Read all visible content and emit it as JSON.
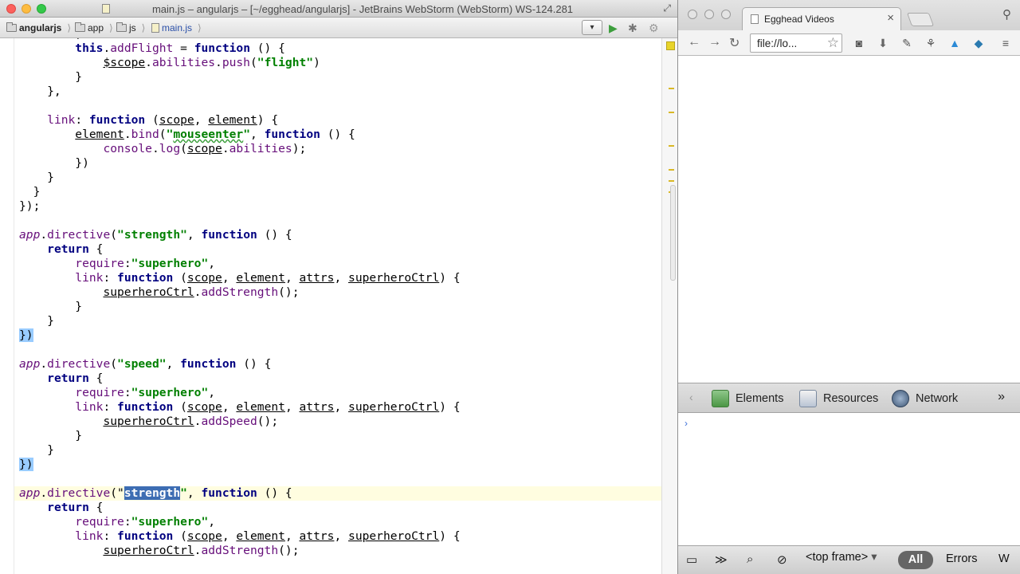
{
  "ide": {
    "title": "main.js – angularjs – [~/egghead/angularjs] - JetBrains WebStorm (WebStorm) WS-124.281",
    "breadcrumbs": [
      "angularjs",
      "app",
      "js",
      "main.js"
    ],
    "run_dropdown": "▾"
  },
  "editor": {
    "lines": [
      [
        {
          "t": "        ;"
        }
      ],
      [
        {
          "t": "        "
        },
        {
          "t": "this",
          "c": "kw"
        },
        {
          "t": "."
        },
        {
          "t": "addFlight",
          "c": "prop"
        },
        {
          "t": " = "
        },
        {
          "t": "function",
          "c": "kw"
        },
        {
          "t": " () {"
        }
      ],
      [
        {
          "t": "            "
        },
        {
          "t": "$scope",
          "c": "ul"
        },
        {
          "t": "."
        },
        {
          "t": "abilities",
          "c": "prop"
        },
        {
          "t": "."
        },
        {
          "t": "push",
          "c": "prop"
        },
        {
          "t": "("
        },
        {
          "t": "\"flight\"",
          "c": "str"
        },
        {
          "t": ")"
        }
      ],
      [
        {
          "t": "        }"
        }
      ],
      [
        {
          "t": "    },"
        }
      ],
      [
        {
          "t": ""
        }
      ],
      [
        {
          "t": "    "
        },
        {
          "t": "link",
          "c": "prop"
        },
        {
          "t": ": "
        },
        {
          "t": "function",
          "c": "kw"
        },
        {
          "t": " ("
        },
        {
          "t": "scope",
          "c": "ul"
        },
        {
          "t": ", "
        },
        {
          "t": "element",
          "c": "ul"
        },
        {
          "t": ") {"
        }
      ],
      [
        {
          "t": "        "
        },
        {
          "t": "element",
          "c": "ul"
        },
        {
          "t": "."
        },
        {
          "t": "bind",
          "c": "prop"
        },
        {
          "t": "("
        },
        {
          "t": "\"",
          "c": "str"
        },
        {
          "t": "mouseenter",
          "c": "str squig"
        },
        {
          "t": "\"",
          "c": "str"
        },
        {
          "t": ", "
        },
        {
          "t": "function",
          "c": "kw"
        },
        {
          "t": " () {"
        }
      ],
      [
        {
          "t": "            "
        },
        {
          "t": "console",
          "c": "prop"
        },
        {
          "t": "."
        },
        {
          "t": "log",
          "c": "prop"
        },
        {
          "t": "("
        },
        {
          "t": "scope",
          "c": "ul"
        },
        {
          "t": "."
        },
        {
          "t": "abilities",
          "c": "prop"
        },
        {
          "t": ");"
        }
      ],
      [
        {
          "t": "        })"
        }
      ],
      [
        {
          "t": "    }"
        }
      ],
      [
        {
          "t": "  }"
        }
      ],
      [
        {
          "t": "});"
        }
      ],
      [
        {
          "t": ""
        }
      ],
      [
        {
          "t": "app",
          "c": "obj"
        },
        {
          "t": "."
        },
        {
          "t": "directive",
          "c": "prop"
        },
        {
          "t": "("
        },
        {
          "t": "\"strength\"",
          "c": "str"
        },
        {
          "t": ", "
        },
        {
          "t": "function",
          "c": "kw"
        },
        {
          "t": " () {"
        }
      ],
      [
        {
          "t": "    "
        },
        {
          "t": "return",
          "c": "kw"
        },
        {
          "t": " {"
        }
      ],
      [
        {
          "t": "        "
        },
        {
          "t": "require",
          "c": "prop"
        },
        {
          "t": ":"
        },
        {
          "t": "\"superhero\"",
          "c": "str"
        },
        {
          "t": ","
        }
      ],
      [
        {
          "t": "        "
        },
        {
          "t": "link",
          "c": "prop"
        },
        {
          "t": ": "
        },
        {
          "t": "function",
          "c": "kw"
        },
        {
          "t": " ("
        },
        {
          "t": "scope",
          "c": "ul"
        },
        {
          "t": ", "
        },
        {
          "t": "element",
          "c": "ul"
        },
        {
          "t": ", "
        },
        {
          "t": "attrs",
          "c": "ul"
        },
        {
          "t": ", "
        },
        {
          "t": "superheroCtrl",
          "c": "ul"
        },
        {
          "t": ") {"
        }
      ],
      [
        {
          "t": "            "
        },
        {
          "t": "superheroCtrl",
          "c": "ul"
        },
        {
          "t": "."
        },
        {
          "t": "addStrength",
          "c": "prop"
        },
        {
          "t": "();"
        }
      ],
      [
        {
          "t": "        }"
        }
      ],
      [
        {
          "t": "    }"
        }
      ],
      [
        {
          "t": "})",
          "c": "br"
        }
      ],
      [
        {
          "t": ""
        }
      ],
      [
        {
          "t": "app",
          "c": "obj"
        },
        {
          "t": "."
        },
        {
          "t": "directive",
          "c": "prop"
        },
        {
          "t": "("
        },
        {
          "t": "\"speed\"",
          "c": "str"
        },
        {
          "t": ", "
        },
        {
          "t": "function",
          "c": "kw"
        },
        {
          "t": " () {"
        }
      ],
      [
        {
          "t": "    "
        },
        {
          "t": "return",
          "c": "kw"
        },
        {
          "t": " {"
        }
      ],
      [
        {
          "t": "        "
        },
        {
          "t": "require",
          "c": "prop"
        },
        {
          "t": ":"
        },
        {
          "t": "\"superhero\"",
          "c": "str"
        },
        {
          "t": ","
        }
      ],
      [
        {
          "t": "        "
        },
        {
          "t": "link",
          "c": "prop"
        },
        {
          "t": ": "
        },
        {
          "t": "function",
          "c": "kw"
        },
        {
          "t": " ("
        },
        {
          "t": "scope",
          "c": "ul"
        },
        {
          "t": ", "
        },
        {
          "t": "element",
          "c": "ul"
        },
        {
          "t": ", "
        },
        {
          "t": "attrs",
          "c": "ul"
        },
        {
          "t": ", "
        },
        {
          "t": "superheroCtrl",
          "c": "ul"
        },
        {
          "t": ") {"
        }
      ],
      [
        {
          "t": "            "
        },
        {
          "t": "superheroCtrl",
          "c": "ul"
        },
        {
          "t": "."
        },
        {
          "t": "addSpeed",
          "c": "prop"
        },
        {
          "t": "();"
        }
      ],
      [
        {
          "t": "        }"
        }
      ],
      [
        {
          "t": "    }"
        }
      ],
      [
        {
          "t": "})",
          "c": "br"
        }
      ],
      [
        {
          "t": ""
        }
      ],
      [
        {
          "t": "app",
          "c": "obj"
        },
        {
          "t": "."
        },
        {
          "t": "directive",
          "c": "prop"
        },
        {
          "t": "(\""
        },
        {
          "t": "strength",
          "c": "sel"
        },
        {
          "t": "\"",
          "c": "str"
        },
        {
          "t": ", "
        },
        {
          "t": "function",
          "c": "kw"
        },
        {
          "t": " () {"
        }
      ],
      [
        {
          "t": "    "
        },
        {
          "t": "return",
          "c": "kw"
        },
        {
          "t": " {"
        }
      ],
      [
        {
          "t": "        "
        },
        {
          "t": "require",
          "c": "prop"
        },
        {
          "t": ":"
        },
        {
          "t": "\"superhero\"",
          "c": "str"
        },
        {
          "t": ","
        }
      ],
      [
        {
          "t": "        "
        },
        {
          "t": "link",
          "c": "prop"
        },
        {
          "t": ": "
        },
        {
          "t": "function",
          "c": "kw"
        },
        {
          "t": " ("
        },
        {
          "t": "scope",
          "c": "ul"
        },
        {
          "t": ", "
        },
        {
          "t": "element",
          "c": "ul"
        },
        {
          "t": ", "
        },
        {
          "t": "attrs",
          "c": "ul"
        },
        {
          "t": ", "
        },
        {
          "t": "superheroCtrl",
          "c": "ul"
        },
        {
          "t": ") {"
        }
      ],
      [
        {
          "t": "            "
        },
        {
          "t": "superheroCtrl",
          "c": "ul"
        },
        {
          "t": "."
        },
        {
          "t": "addStrength",
          "c": "prop"
        },
        {
          "t": "();"
        }
      ]
    ],
    "current_line": 32
  },
  "browser": {
    "tab_title": "Egghead Videos",
    "address": "file://lo...",
    "devtools": {
      "tabs": [
        "Elements",
        "Resources",
        "Network"
      ],
      "more": "»",
      "prompt": "›",
      "frame_selector": "<top frame>",
      "filter_all": "All",
      "filter_errors": "Errors",
      "filter_warnings": "W"
    }
  },
  "colors": {
    "keyword": "#000080",
    "string": "#008000",
    "property": "#660e7a",
    "selection": "#3d6db3",
    "brace_match": "#99ccff",
    "current_line": "#fffde0"
  }
}
